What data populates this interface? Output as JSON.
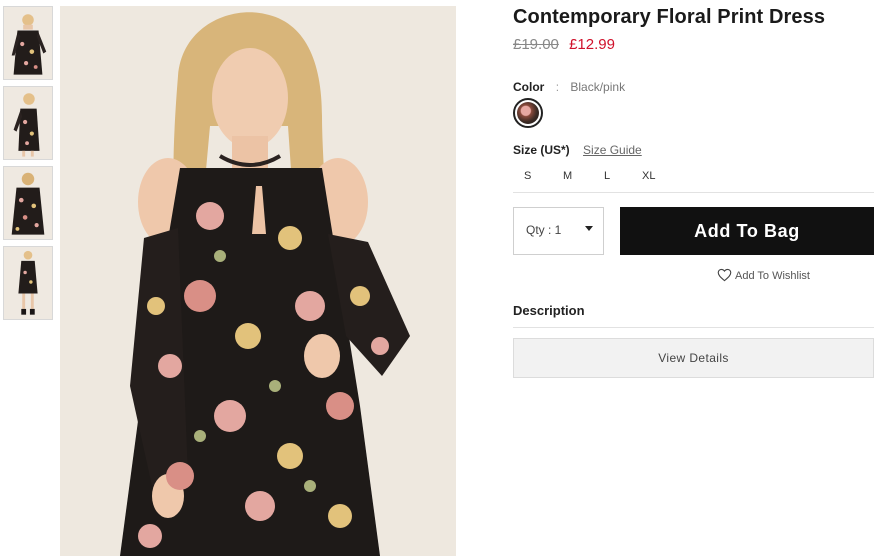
{
  "product": {
    "title": "Contemporary Floral Print Dress",
    "price_original": "£19.00",
    "price_sale": "£12.99"
  },
  "color": {
    "label": "Color",
    "separator": ":",
    "value": "Black/pink"
  },
  "size": {
    "label": "Size (US*)",
    "guide_link": "Size Guide",
    "options": [
      "S",
      "M",
      "L",
      "XL"
    ]
  },
  "quantity": {
    "label": "Qty : 1"
  },
  "actions": {
    "add_to_bag": "Add To Bag",
    "wishlist": "Add To Wishlist"
  },
  "description": {
    "title": "Description",
    "view_details": "View Details"
  },
  "colors": {
    "sale_price": "#d0112b",
    "primary_button": "#111111",
    "dress_base": "#1e1a18",
    "flower_pink": "#e3a7a0",
    "flower_yellow": "#e2c27b"
  },
  "thumbnails": [
    {
      "view": "front"
    },
    {
      "view": "side"
    },
    {
      "view": "back"
    },
    {
      "view": "full-length"
    }
  ]
}
